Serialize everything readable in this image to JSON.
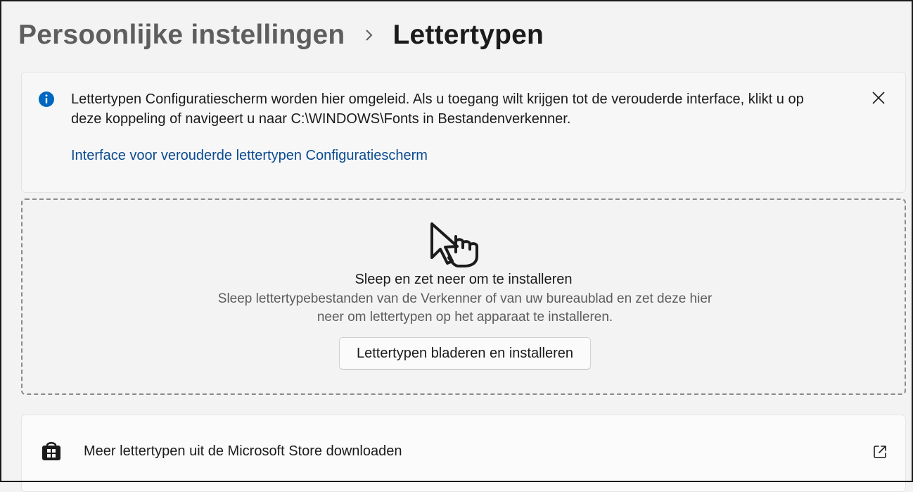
{
  "breadcrumb": {
    "parent": "Persoonlijke instellingen",
    "separator_icon": "chevron-right-icon",
    "current": "Lettertypen"
  },
  "infobar": {
    "icon": "info-icon",
    "message": "Lettertypen Configuratiescherm worden hier omgeleid. Als u toegang wilt krijgen tot de verouderde interface, klikt u op deze koppeling of navigeert u naar C:\\WINDOWS\\Fonts in Bestandenverkenner.",
    "link": "Interface voor verouderde lettertypen Configuratiescherm",
    "close_icon": "close-icon"
  },
  "dropzone": {
    "icon": "drag-drop-hand-icon",
    "title": "Sleep en zet neer om te installeren",
    "description": "Sleep lettertypebestanden van de Verkenner of van uw bureaublad en zet deze hier neer om lettertypen op het apparaat te installeren.",
    "button": "Lettertypen bladeren en installeren"
  },
  "store": {
    "icon": "microsoft-store-icon",
    "label": "Meer lettertypen uit de Microsoft Store downloaden",
    "action_icon": "external-link-icon"
  },
  "colors": {
    "accent": "#0067c0",
    "link": "#0a4a8f",
    "background": "#f3f3f3"
  }
}
